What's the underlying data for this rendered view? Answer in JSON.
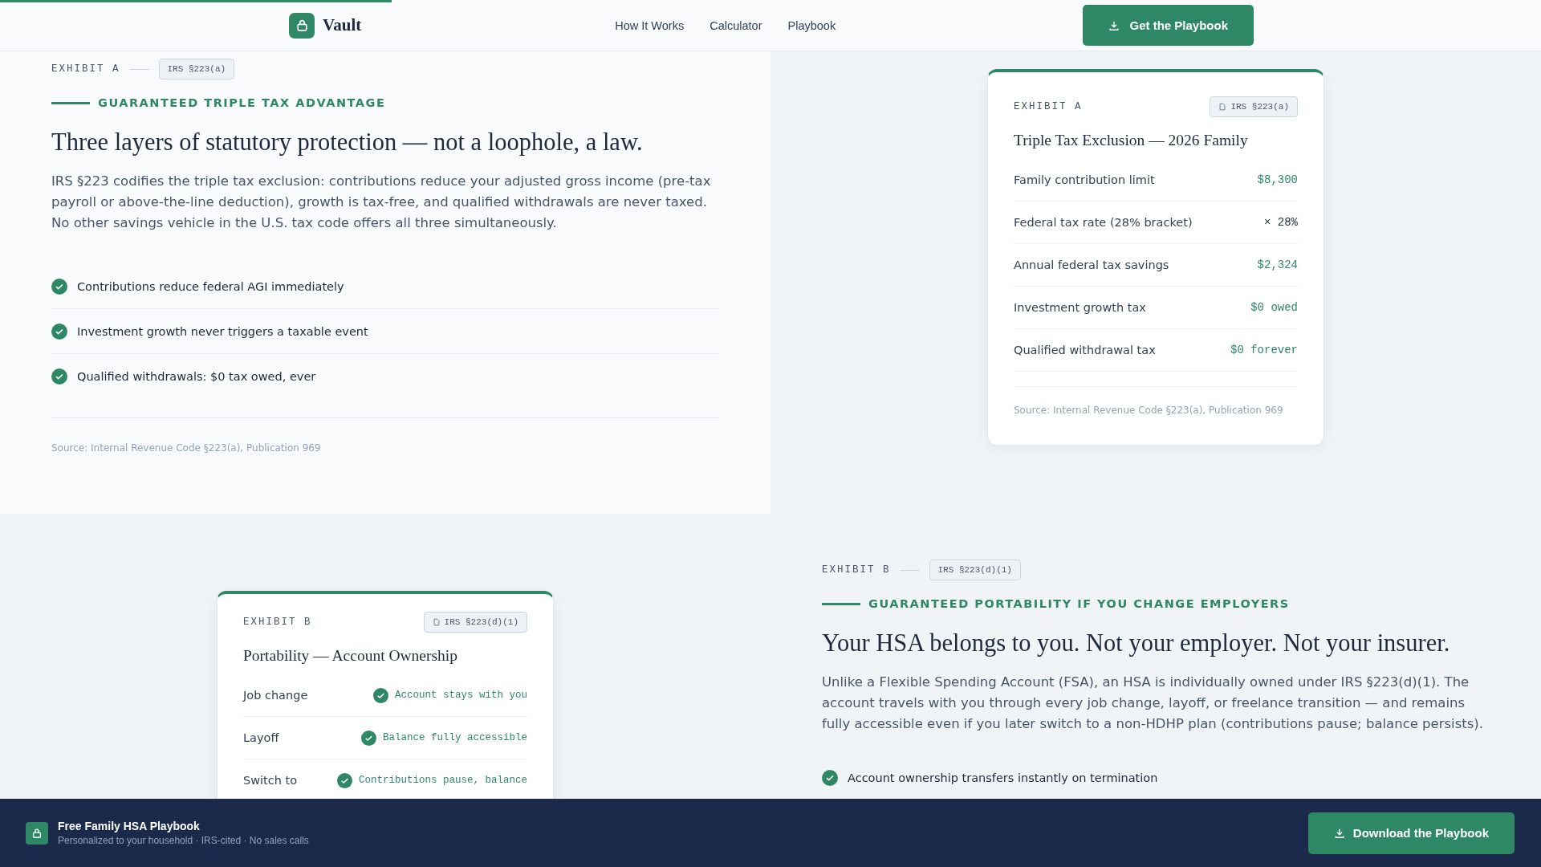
{
  "reading_progress": {
    "level": 0.254
  },
  "header": {
    "logo": "Vault",
    "nav": [
      "How It Works",
      "Calculator",
      "Playbook"
    ],
    "cta": "Get the Playbook"
  },
  "sections": [
    {
      "card_first": false,
      "exhibit": "EXHIBIT A",
      "citation": "IRS §223(a)",
      "eyebrow": "GUARANTEED TRIPLE TAX ADVANTAGE",
      "heading": "Three layers of statutory protection — not a loophole, a law.",
      "body": "IRS §223 codifies the triple tax exclusion: contributions reduce your adjusted gross income (pre-tax payroll or above-the-line deduction), growth is tax-free, and qualified withdrawals are never taxed. No other savings vehicle in the U.S. tax code offers all three simultaneously.",
      "points": [
        "Contributions reduce federal AGI immediately",
        "Investment growth never triggers a taxable event",
        "Qualified withdrawals: $0 tax owed, ever"
      ],
      "source": "Source: Internal Revenue Code §223(a), Publication 969",
      "card": {
        "exhibit": "EXHIBIT A",
        "citation": "IRS §223(a)",
        "title": "Triple Tax Exclusion — 2026 Family",
        "rows": [
          {
            "label": "Family contribution limit",
            "value": "$8,300",
            "kind": "amount"
          },
          {
            "label": "Federal tax rate (28% bracket)",
            "value": "× 28%",
            "kind": "factor"
          },
          {
            "label": "Annual federal tax savings",
            "value": "$2,324",
            "kind": "amount"
          },
          {
            "label": "Investment growth tax",
            "value": "$0 owed",
            "kind": "amount"
          },
          {
            "label": "Qualified withdrawal tax",
            "value": "$0 forever",
            "kind": "amount"
          }
        ],
        "source": "Source: Internal Revenue Code §223(a), Publication 969"
      }
    },
    {
      "card_first": true,
      "exhibit": "EXHIBIT B",
      "citation": "IRS §223(d)(1)",
      "eyebrow": "GUARANTEED PORTABILITY IF YOU CHANGE EMPLOYERS",
      "heading": "Your HSA belongs to you. Not your employer. Not your insurer.",
      "body": "Unlike a Flexible Spending Account (FSA), an HSA is individually owned under IRS §223(d)(1). The account travels with you through every job change, layoff, or freelance transition — and remains fully accessible even if you later switch to a non-HDHP plan (contributions pause; balance persists).",
      "points": [
        "Account ownership transfers instantly on termination"
      ],
      "card": {
        "exhibit": "EXHIBIT B",
        "citation": "IRS §223(d)(1)",
        "title": "Portability — Account Ownership",
        "rows": [
          {
            "label": "Job change",
            "value": "Account stays with you",
            "kind": "status"
          },
          {
            "label": "Layoff",
            "value": "Balance fully accessible",
            "kind": "status"
          },
          {
            "label": "Switch to",
            "value": "Contributions pause, balance",
            "kind": "status"
          }
        ]
      }
    }
  ],
  "bottom_bar": {
    "title": "Free Family HSA Playbook",
    "subtitle": "Personalized to your household · IRS-cited · No sales calls",
    "cta": "Download the Playbook"
  }
}
